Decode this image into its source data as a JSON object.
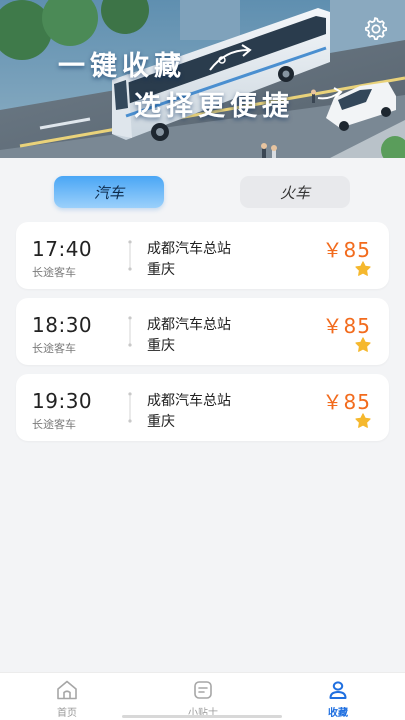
{
  "hero": {
    "title_line1": "一键收藏",
    "title_line2": "选择更便捷",
    "settings_icon": "gear-icon"
  },
  "tabs": [
    {
      "label": "汽车",
      "active": true
    },
    {
      "label": "火车",
      "active": false
    }
  ],
  "tickets": [
    {
      "time": "17:40",
      "type": "长途客车",
      "from": "成都汽车总站",
      "to": "重庆",
      "price": "￥85",
      "favorited": true
    },
    {
      "time": "18:30",
      "type": "长途客车",
      "from": "成都汽车总站",
      "to": "重庆",
      "price": "￥85",
      "favorited": true
    },
    {
      "time": "19:30",
      "type": "长途客车",
      "from": "成都汽车总站",
      "to": "重庆",
      "price": "￥85",
      "favorited": true
    }
  ],
  "bottom_nav": [
    {
      "label": "首页",
      "icon": "home-icon",
      "active": false
    },
    {
      "label": "小贴士",
      "icon": "tips-icon",
      "active": false
    },
    {
      "label": "收藏",
      "icon": "user-icon",
      "active": true
    }
  ],
  "colors": {
    "accent": "#1f6fe0",
    "price": "#f26b1d",
    "star": "#f5b82e",
    "tab_active": "#4aa6f5"
  }
}
